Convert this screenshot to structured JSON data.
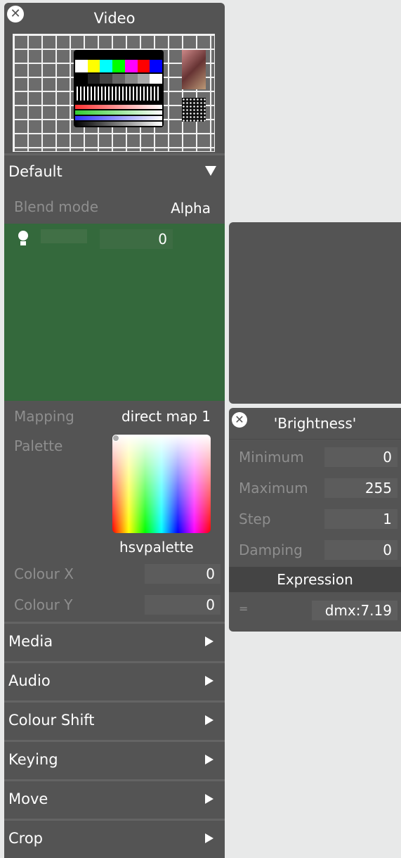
{
  "panel": {
    "title": "Video",
    "section_default": "Default",
    "blend_mode_label": "Blend mode",
    "blend_mode_value": "Alpha",
    "brightness_value": "0",
    "mapping_label": "Mapping",
    "mapping_value": "direct map 1",
    "palette_label": "Palette",
    "palette_name": "hsvpalette",
    "colour_x_label": "Colour X",
    "colour_x_value": "0",
    "colour_y_label": "Colour Y",
    "colour_y_value": "0",
    "sections": [
      "Media",
      "Audio",
      "Colour Shift",
      "Keying",
      "Move",
      "Crop"
    ]
  },
  "popup": {
    "title": "'Brightness'",
    "minimum_label": "Minimum",
    "minimum_value": "0",
    "maximum_label": "Maximum",
    "maximum_value": "255",
    "step_label": "Step",
    "step_value": "1",
    "damping_label": "Damping",
    "damping_value": "0",
    "expression_label": "Expression",
    "expression_eq": "=",
    "expression_value": "dmx:7.19"
  },
  "colors": {
    "panel_bg": "#545454",
    "green": "#34693c",
    "page_bg": "#e8e9e9"
  },
  "icons": [
    "close-icon",
    "bulb-icon",
    "chevron-down-icon",
    "chevron-right-icon"
  ]
}
